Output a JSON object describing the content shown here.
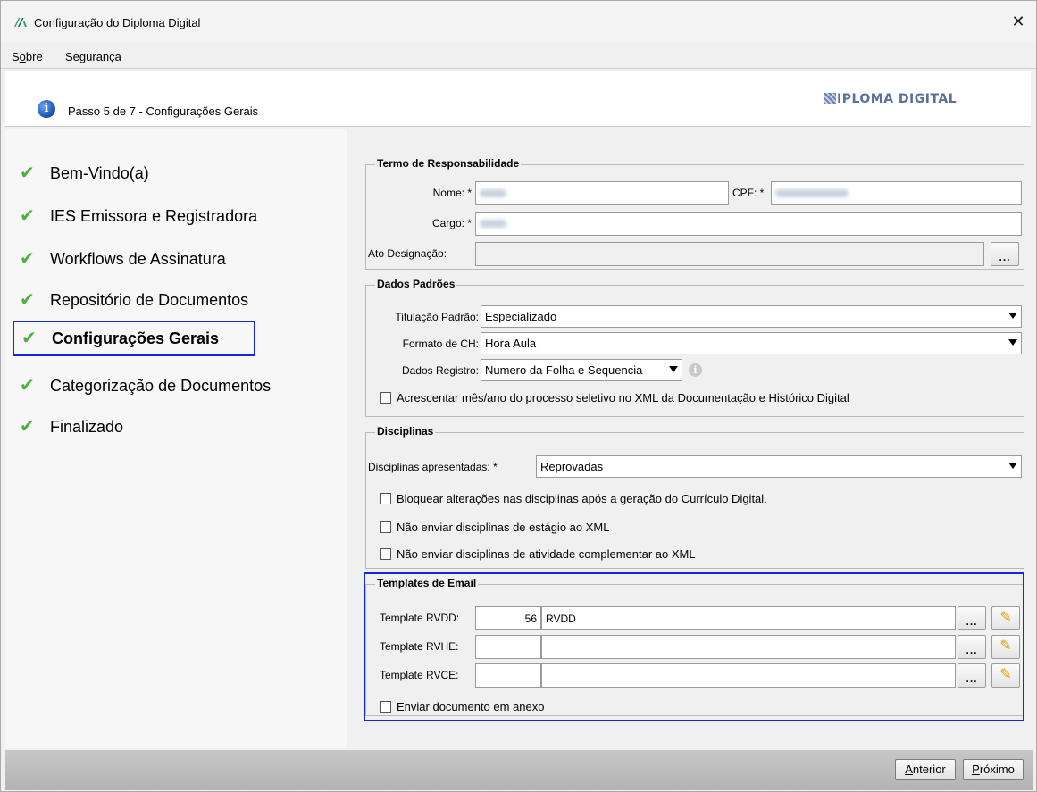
{
  "window": {
    "title": "Configuração do Diploma Digital",
    "close_glyph": "✕"
  },
  "menu": {
    "items": [
      {
        "pre": "S",
        "u": "o",
        "post": "bre"
      },
      {
        "pre": "Segurança",
        "u": "",
        "post": ""
      }
    ]
  },
  "header": {
    "step_text": "Passo 5 de 7 - Configurações Gerais",
    "logo_text": "IPLOMA DIGITAL",
    "info_icon": "info-icon"
  },
  "nav": {
    "check_glyph": "✔",
    "items": [
      {
        "label": "Bem-Vindo(a)"
      },
      {
        "label": "IES Emissora e Registradora"
      },
      {
        "label": "Workflows de Assinatura"
      },
      {
        "label": "Repositório de Documentos"
      },
      {
        "label": "Configurações Gerais"
      },
      {
        "label": "Categorização de Documentos"
      },
      {
        "label": "Finalizado"
      }
    ]
  },
  "termo": {
    "legend": "Termo de Responsabilidade",
    "nome_label": "Nome: *",
    "cpf_label": "CPF: *",
    "cargo_label": "Cargo: *",
    "ato_label": "Ato Designação:",
    "ato_button": "..."
  },
  "dados": {
    "legend": "Dados Padrões",
    "titulacao_label": "Titulação Padrão:",
    "titulacao_value": "Especializado",
    "formato_label": "Formato de CH:",
    "formato_value": "Hora Aula",
    "registro_label": "Dados Registro:",
    "registro_value": "Numero da Folha e Sequencia",
    "acrescentar_label": "Acrescentar mês/ano do processo seletivo no XML da Documentação e Histórico Digital"
  },
  "disciplinas": {
    "legend": "Disciplinas",
    "apresentadas_label": "Disciplinas apresentadas: *",
    "apresentadas_value": "Reprovadas",
    "bloquear_label": "Bloquear alterações nas disciplinas após a geração do Currículo Digital.",
    "estagio_label": "Não enviar disciplinas de estágio ao XML",
    "atividade_label": "Não enviar disciplinas de atividade complementar ao XML"
  },
  "templates": {
    "legend": "Templates de Email",
    "rows": [
      {
        "label": "Template RVDD:",
        "code": "56",
        "name": "RVDD"
      },
      {
        "label": "Template RVHE:",
        "code": "",
        "name": ""
      },
      {
        "label": "Template RVCE:",
        "code": "",
        "name": ""
      }
    ],
    "dots": "...",
    "pencil_glyph": "✎",
    "anexo_label": "Enviar documento em anexo"
  },
  "footer": {
    "anterior": {
      "pre": "",
      "u": "A",
      "post": "nterior"
    },
    "proximo": {
      "pre": "",
      "u": "P",
      "post": "róximo"
    }
  }
}
